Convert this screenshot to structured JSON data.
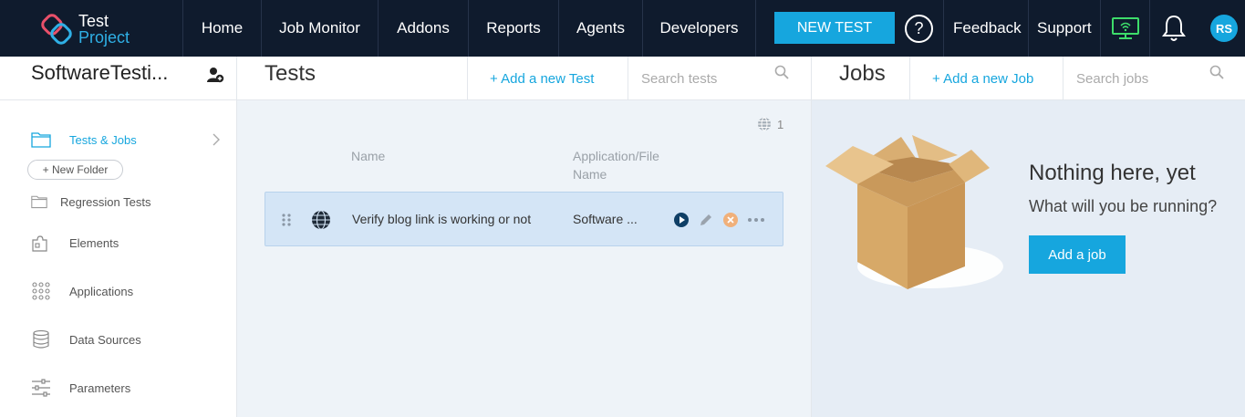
{
  "brand": {
    "line1": "Test",
    "line2": "Project"
  },
  "nav": {
    "items": [
      "Home",
      "Job Monitor",
      "Addons",
      "Reports",
      "Agents",
      "Developers"
    ],
    "new_test": "NEW TEST",
    "help": "?",
    "feedback": "Feedback",
    "support": "Support",
    "avatar": "RS"
  },
  "sidebar": {
    "project_name": "SoftwareTesti...",
    "items": [
      {
        "label": "Tests & Jobs",
        "icon": "folder-icon",
        "active": true
      },
      {
        "label": "Regression Tests",
        "icon": "folder-icon",
        "active": false
      },
      {
        "label": "Elements",
        "icon": "puzzle-icon",
        "active": false
      },
      {
        "label": "Applications",
        "icon": "grid-icon",
        "active": false
      },
      {
        "label": "Data Sources",
        "icon": "database-icon",
        "active": false
      },
      {
        "label": "Parameters",
        "icon": "sliders-icon",
        "active": false
      }
    ],
    "new_folder": "+ New Folder"
  },
  "tests": {
    "title": "Tests",
    "add_label": "+  Add a new Test",
    "search_placeholder": "Search tests",
    "count": "1",
    "columns": {
      "name": "Name",
      "app_line1": "Application/File",
      "app_line2": "Name"
    },
    "rows": [
      {
        "name": "Verify blog link is working or not",
        "app": "Software ..."
      }
    ]
  },
  "jobs": {
    "title": "Jobs",
    "add_label": "+  Add a new Job",
    "search_placeholder": "Search jobs",
    "empty_title": "Nothing here, yet",
    "empty_sub": "What will you be running?",
    "add_button": "Add a job"
  },
  "colors": {
    "nav_bg": "#0f1b2d",
    "accent": "#16a6de",
    "row_bg": "#d4e5f6",
    "panel_bg": "#eef3f8"
  }
}
